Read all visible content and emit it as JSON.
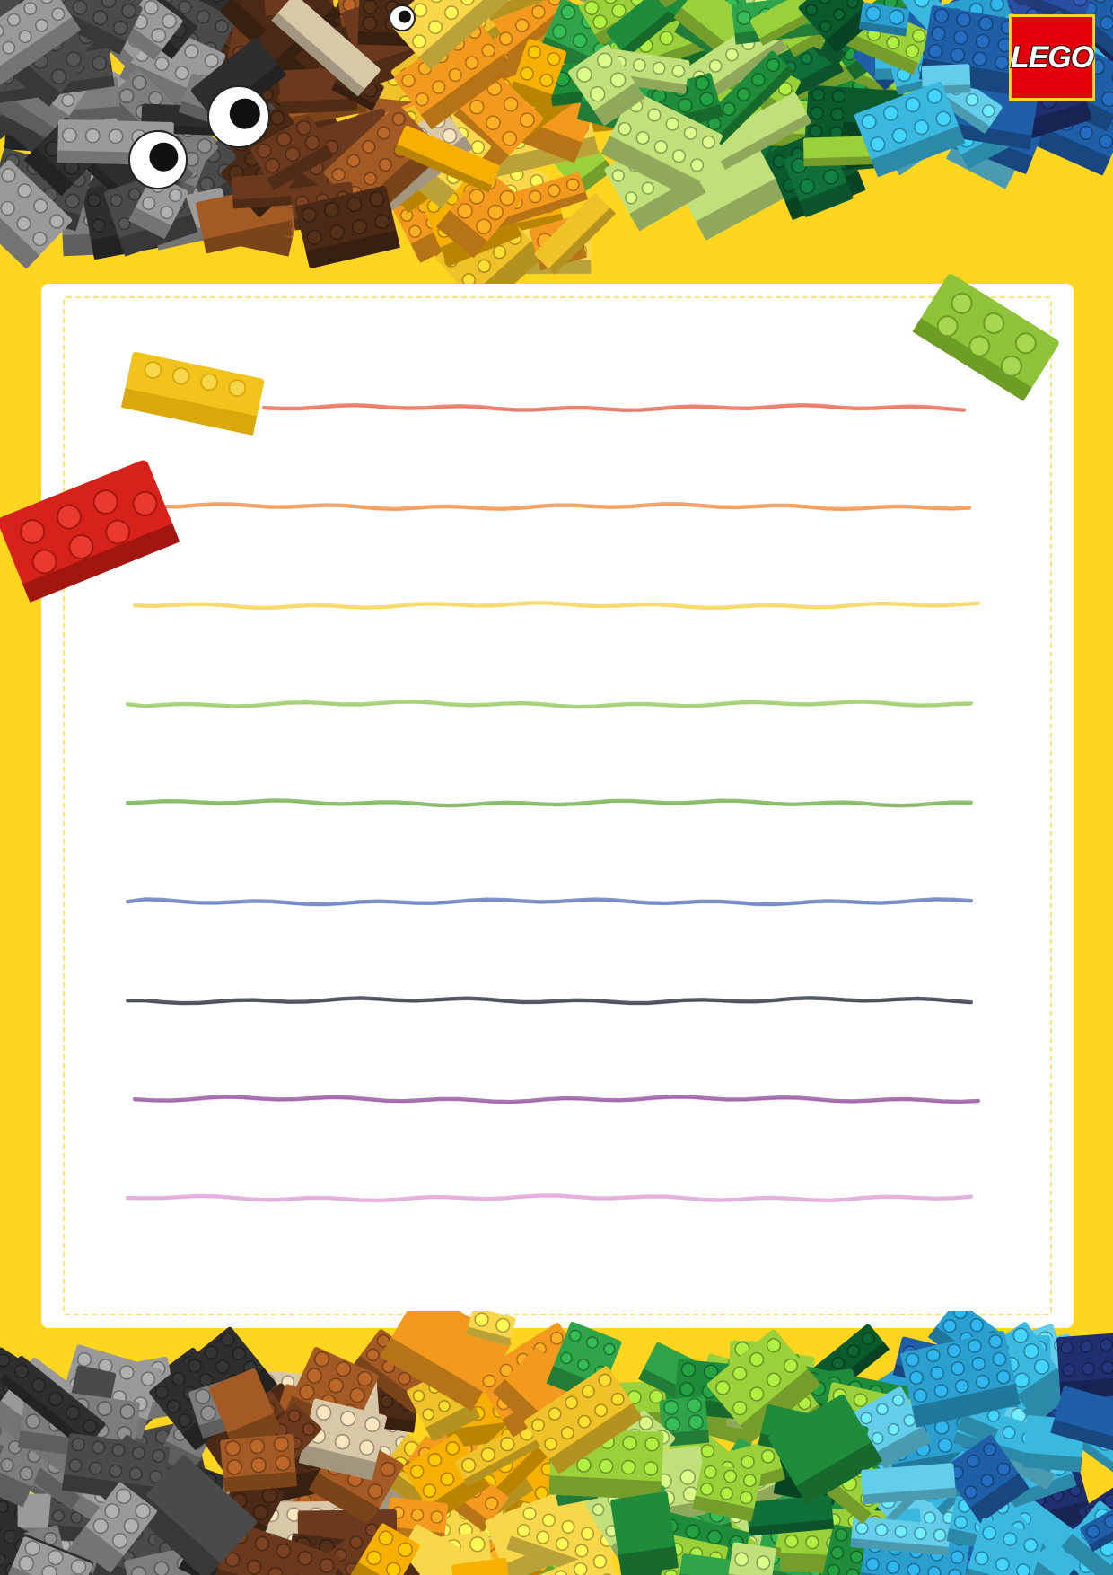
{
  "page": {
    "background_color": "#ffd51f",
    "paper_color": "#ffffff",
    "paper_border_color": "#fde27a"
  },
  "logo": {
    "text": "LEGO",
    "background_color": "#e3000b"
  },
  "writing_lines": [
    {
      "color": "#e9705a"
    },
    {
      "color": "#f3954f"
    },
    {
      "color": "#f6d75a"
    },
    {
      "color": "#9ccc6a"
    },
    {
      "color": "#7db45a"
    },
    {
      "color": "#6a7fc0"
    },
    {
      "color": "#3a3f4e"
    },
    {
      "color": "#9c5ca8"
    },
    {
      "color": "#e0a6d8"
    }
  ],
  "brick_palette": [
    "#7d7d7d",
    "#4a4a4a",
    "#6b3a1e",
    "#a35a24",
    "#f0c22a",
    "#f39a1e",
    "#9ad13a",
    "#1e8c3a",
    "#10703a",
    "#3ab8e0",
    "#1f5fa8",
    "#1f2f6e",
    "#e23020",
    "#f2f2f2"
  ]
}
